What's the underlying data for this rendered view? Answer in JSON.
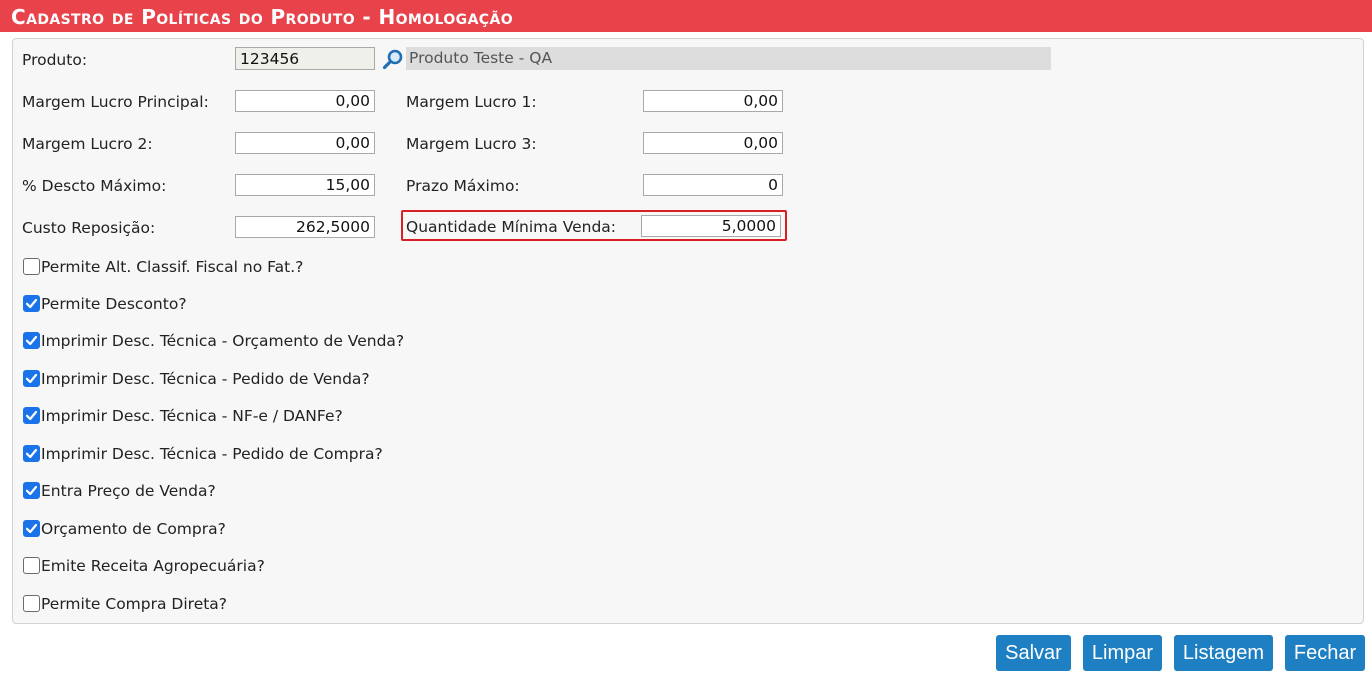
{
  "header": {
    "title": "Cadastro de Políticas do Produto  - Homologação"
  },
  "form": {
    "produto": {
      "label": "Produto:",
      "code": "123456",
      "description": "Produto Teste - QA"
    },
    "margem_principal": {
      "label": "Margem Lucro Principal:",
      "value": "0,00"
    },
    "margem_1": {
      "label": "Margem Lucro 1:",
      "value": "0,00"
    },
    "margem_2": {
      "label": "Margem Lucro 2:",
      "value": "0,00"
    },
    "margem_3": {
      "label": "Margem Lucro 3:",
      "value": "0,00"
    },
    "descto_maximo": {
      "label": "% Descto Máximo:",
      "value": "15,00"
    },
    "prazo_maximo": {
      "label": "Prazo Máximo:",
      "value": "0"
    },
    "custo_reposicao": {
      "label": "Custo Reposição:",
      "value": "262,5000"
    },
    "qtd_minima": {
      "label": "Quantidade Mínima Venda:",
      "value": "5,0000"
    }
  },
  "checkboxes": [
    {
      "label": "Permite Alt. Classif. Fiscal no Fat.?",
      "checked": false
    },
    {
      "label": "Permite Desconto?",
      "checked": true
    },
    {
      "label": "Imprimir Desc. Técnica - Orçamento de Venda?",
      "checked": true
    },
    {
      "label": "Imprimir Desc. Técnica - Pedido de Venda?",
      "checked": true
    },
    {
      "label": "Imprimir Desc. Técnica - NF-e / DANFe?",
      "checked": true
    },
    {
      "label": "Imprimir Desc. Técnica - Pedido de Compra?",
      "checked": true
    },
    {
      "label": "Entra Preço de Venda?",
      "checked": true
    },
    {
      "label": "Orçamento de Compra?",
      "checked": true
    },
    {
      "label": "Emite Receita Agropecuária?",
      "checked": false
    },
    {
      "label": "Permite Compra Direta?",
      "checked": false
    }
  ],
  "buttons": {
    "salvar": "Salvar",
    "limpar": "Limpar",
    "listagem": "Listagem",
    "fechar": "Fechar"
  },
  "colors": {
    "header_bg": "#e8424a",
    "button_bg": "#1f7fc3",
    "checkbox_on": "#1a73e8",
    "highlight_border": "#d91f26"
  },
  "icons": {
    "search": "search-icon",
    "check": "check-icon"
  }
}
